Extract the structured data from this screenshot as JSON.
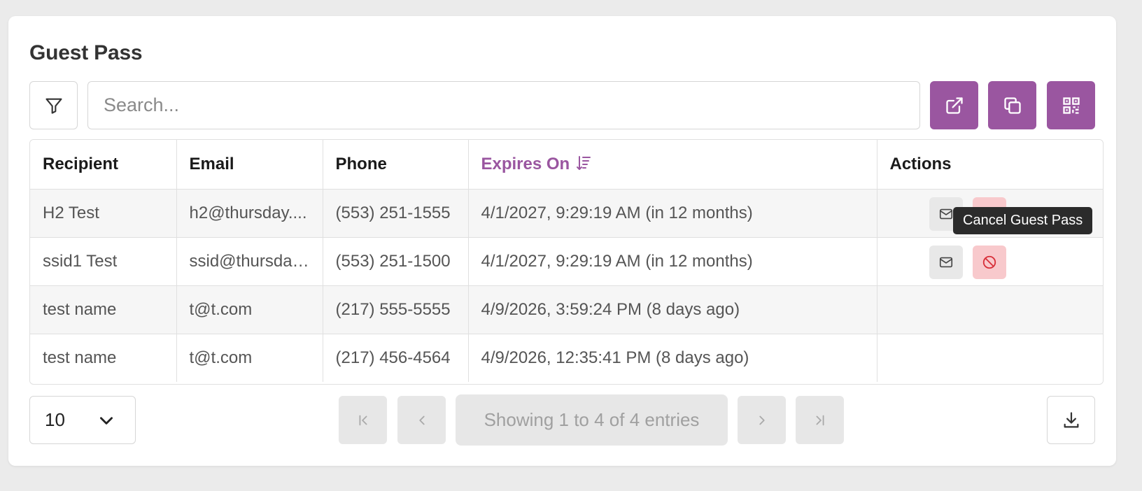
{
  "title": "Guest Pass",
  "search": {
    "placeholder": "Search..."
  },
  "icons": {
    "filter": "filter-icon",
    "open": "external-link-icon",
    "copy": "copy-icon",
    "qr": "qr-code-icon",
    "mail": "mail-icon",
    "cancel": "ban-icon",
    "download": "download-icon"
  },
  "colors": {
    "accent": "#9a56a0",
    "cancel_bg": "#f8c9cc",
    "cancel_icon": "#d8303a"
  },
  "table": {
    "headers": {
      "recipient": "Recipient",
      "email": "Email",
      "phone": "Phone",
      "expires": "Expires On",
      "actions": "Actions"
    },
    "rows": [
      {
        "recipient": "H2 Test",
        "email": "h2@thursday....",
        "phone": "(553) 251-1555",
        "expires": "4/1/2027, 9:29:19 AM (in 12 months)"
      },
      {
        "recipient": "ssid1 Test",
        "email": "ssid@thursday...",
        "phone": "(553) 251-1500",
        "expires": "4/1/2027, 9:29:19 AM (in 12 months)"
      },
      {
        "recipient": "test name",
        "email": "t@t.com",
        "phone": "(217) 555-5555",
        "expires": "4/9/2026, 3:59:24 PM (8 days ago)"
      },
      {
        "recipient": "test name",
        "email": "t@t.com",
        "phone": "(217) 456-4564",
        "expires": "4/9/2026, 12:35:41 PM (8 days ago)"
      }
    ]
  },
  "tooltip": "Cancel Guest Pass",
  "pagination": {
    "page_size": "10",
    "info": "Showing 1 to 4 of 4 entries"
  }
}
